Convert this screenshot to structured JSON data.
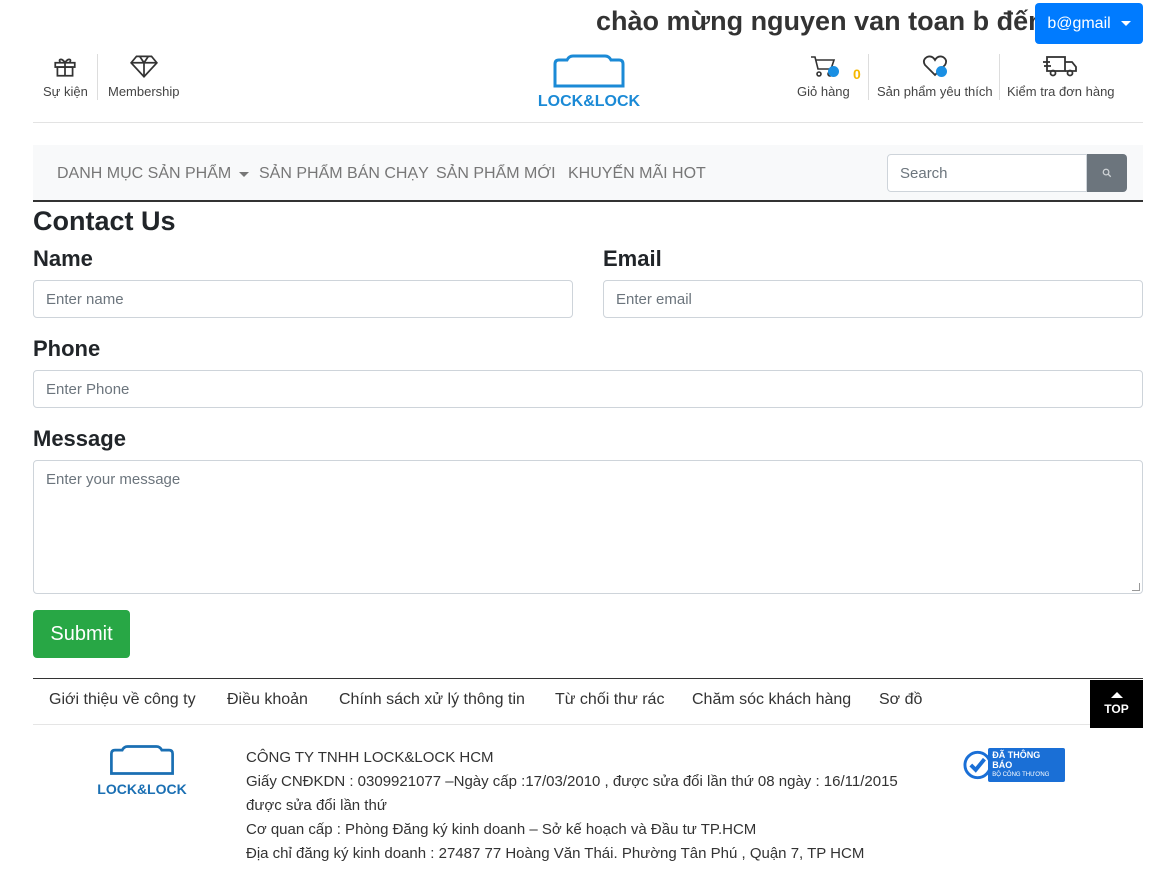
{
  "header": {
    "welcome_text": "chào mừng nguyen van toan b đến",
    "account_label": "b@gmail",
    "left_links": [
      {
        "label": "Sự kiện",
        "icon": "gift-icon"
      },
      {
        "label": "Membership",
        "icon": "diamond-icon"
      }
    ],
    "logo_text": "LOCK&LOCK",
    "right_links": [
      {
        "label": "Giỏ hàng",
        "icon": "cart-icon"
      },
      {
        "label": "Sản phẩm yêu thích",
        "icon": "heart-icon"
      },
      {
        "label": "Kiểm tra đơn hàng",
        "icon": "truck-icon"
      }
    ],
    "cart_count": "0"
  },
  "nav": {
    "items": [
      "DANH MỤC SẢN PHẨM",
      "SẢN PHẨM BÁN CHẠY",
      "SẢN PHẨM MỚI",
      "KHUYẾN MÃI HOT"
    ],
    "search_placeholder": "Search"
  },
  "form": {
    "title": "Contact Us",
    "name_label": "Name",
    "name_placeholder": "Enter name",
    "email_label": "Email",
    "email_placeholder": "Enter email",
    "phone_label": "Phone",
    "phone_placeholder": "Enter Phone",
    "message_label": "Message",
    "message_placeholder": "Enter your message",
    "submit_label": "Submit"
  },
  "footer": {
    "links": [
      "Giới thiệu về công ty",
      "Điều khoản",
      "Chính sách xử lý thông tin",
      "Từ chối thư rác",
      "Chăm sóc khách hàng",
      "Sơ đồ"
    ],
    "top_label": "TOP",
    "logo_text": "LOCK&LOCK",
    "company_lines": [
      "CÔNG TY TNHH LOCK&LOCK HCM",
      "Giấy CNĐKDN : 0309921077 –Ngày cấp :17/03/2010 , được sửa đổi lần thứ 08 ngày : 16/11/2015",
      "được sửa đổi lần thứ",
      "Cơ quan cấp : Phòng Đăng ký kinh doanh – Sở kế hoạch và Đầu tư TP.HCM",
      "Địa chỉ đăng ký kinh doanh : 27487 77 Hoàng Văn Thái. Phường Tân Phú , Quận 7, TP HCM"
    ],
    "badge_title": "ĐÃ THÔNG BÁO",
    "badge_sub": "BỘ CÔNG THƯƠNG"
  },
  "colors": {
    "primary": "#007bff",
    "success": "#28a745",
    "logo_blue": "#1b8ad6",
    "badge_dot": "#1a8fe3"
  }
}
